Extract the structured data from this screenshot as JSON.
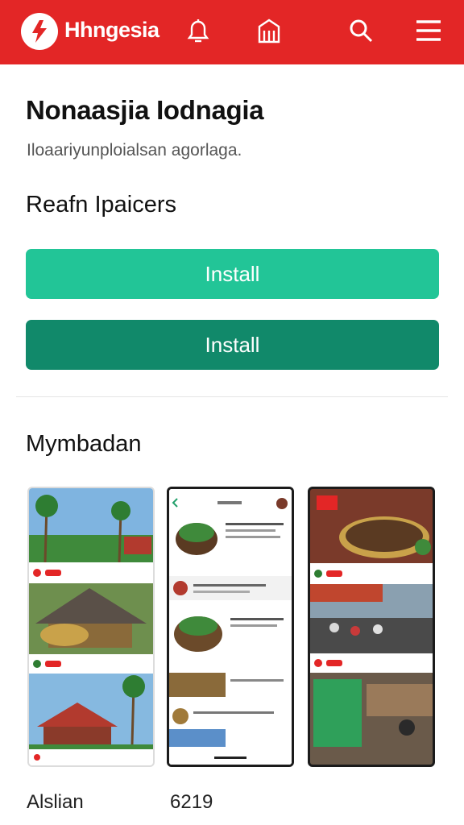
{
  "header": {
    "brand": "Hhngesia",
    "icons": [
      "logo-icon",
      "bell-icon",
      "building-icon",
      "search-icon",
      "menu-icon"
    ],
    "color": "#e32626"
  },
  "main": {
    "title": "Nonaasjia Iodnagia",
    "subtitle": "Iloaariyunploialsan agorlaga.",
    "section_heading": "Reafn Ipaicers",
    "primary_button": "Install",
    "secondary_button": "Install",
    "gallery_heading": "Mymbadan"
  },
  "footer": {
    "left_label": "Alslian",
    "right_label": "6219"
  },
  "colors": {
    "install_primary": "#22c597",
    "install_secondary": "#11896a"
  }
}
